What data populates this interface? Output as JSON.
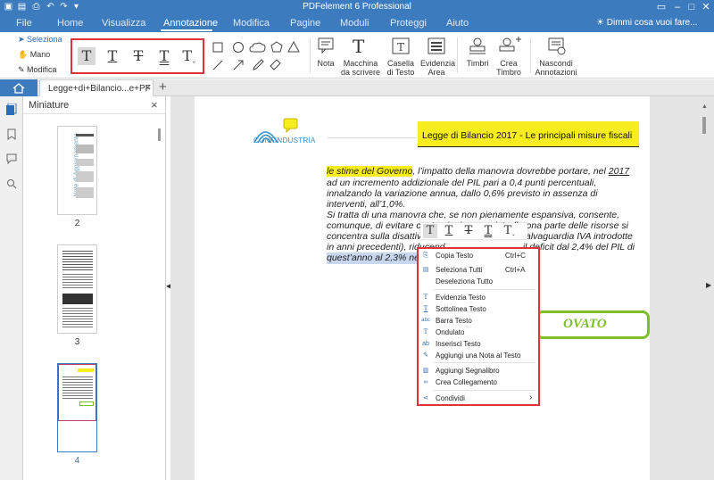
{
  "app": {
    "title": "PDFelement 6 Professional"
  },
  "menubar": {
    "items": [
      "File",
      "Home",
      "Visualizza",
      "Annotazione",
      "Modifica",
      "Pagine",
      "Moduli",
      "Proteggi",
      "Aiuto"
    ],
    "active": "Annotazione",
    "search": "Dimmi cosa vuoi fare..."
  },
  "ribbon": {
    "select": "Seleziona",
    "hand": "Mano",
    "edit": "Modifica",
    "nota": "Nota",
    "macchina": [
      "Macchina",
      "da scrivere"
    ],
    "casella": [
      "Casella",
      "di Testo"
    ],
    "evidenzia": [
      "Evidenzia",
      "Area"
    ],
    "timbri": "Timbri",
    "crea": [
      "Crea",
      "Timbro"
    ],
    "nascondi": [
      "Nascondi",
      "Annotazioni"
    ]
  },
  "tabs": {
    "document": "Legge+di+Bilancio...e+PF",
    "add": "+",
    "close": "×"
  },
  "panel": {
    "title": "Miniature",
    "close": "×",
    "pages": [
      {
        "label": "2"
      },
      {
        "label": "3"
      },
      {
        "label": "4"
      }
    ],
    "thumb_vertical": "Note di Aggiornamento"
  },
  "document": {
    "logo": "CONFINDUSTRIA",
    "header": "Legge di Bilancio 2017 -  Le principali misure fiscali",
    "p1_highlight": "le stime del Governo",
    "p1_rest": ", l’impatto della manovra dovrebbe portare, nel ",
    "p1_year": "2017",
    "p1_l2": "ad un incremento addizionale del PIL pari a 0,4 punti percentuali,",
    "p1_l3": "innalzando la variazione annua, dallo 0,6% previsto in assenza di",
    "p1_l4": "interventi, all’1,0%.",
    "p2_l1": "Si tratta di una manovra che, se non pienamente espansiva, consente,",
    "p2_l2": "comunque, di evitare contrazioni annunciate (buona parte delle risorse si",
    "p2_l3a": "concentra sulla disattiva",
    "p2_l3b": "alvaguardia IVA introdotte",
    "p2_l4a": "in anni precedenti), riducend",
    "p2_l4b": "il deficit dal 2,4% del PIL di",
    "p2_l5": "quest’anno al 2,3% nel",
    "stamp": "OVATO"
  },
  "context_menu": {
    "items": [
      {
        "label": "Copia Testo",
        "shortcut": "Ctrl+C",
        "icon": "copy-icon"
      },
      {
        "label": "Seleziona Tutti",
        "shortcut": "Ctrl+A",
        "icon": "select-all-icon"
      },
      {
        "label": "Deseleziona Tutto",
        "shortcut": "",
        "icon": "deselect-icon"
      },
      {
        "label": "Evidenzia Testo",
        "shortcut": "",
        "icon": "highlight-icon"
      },
      {
        "label": "Sottolinea Testo",
        "shortcut": "",
        "icon": "underline-icon"
      },
      {
        "label": "Barra Testo",
        "shortcut": "",
        "icon": "strikethrough-icon"
      },
      {
        "label": "Ondulato",
        "shortcut": "",
        "icon": "squiggly-icon"
      },
      {
        "label": "Inserisci Testo",
        "shortcut": "",
        "icon": "insert-text-icon"
      },
      {
        "label": "Aggiungi una Nota al Testo",
        "shortcut": "",
        "icon": "note-icon"
      },
      {
        "label": "Aggiungi Segnalibro",
        "shortcut": "",
        "icon": "bookmark-icon"
      },
      {
        "label": "Crea Collegamento",
        "shortcut": "",
        "icon": "link-icon"
      },
      {
        "label": "Condividi",
        "shortcut": "",
        "icon": "share-icon",
        "submenu": "›"
      }
    ]
  },
  "colors": {
    "accent": "#3d7bbf",
    "highlight": "#f7ec1d",
    "annotation_border": "#e0323c",
    "stamp_green": "#7bbf2a"
  }
}
